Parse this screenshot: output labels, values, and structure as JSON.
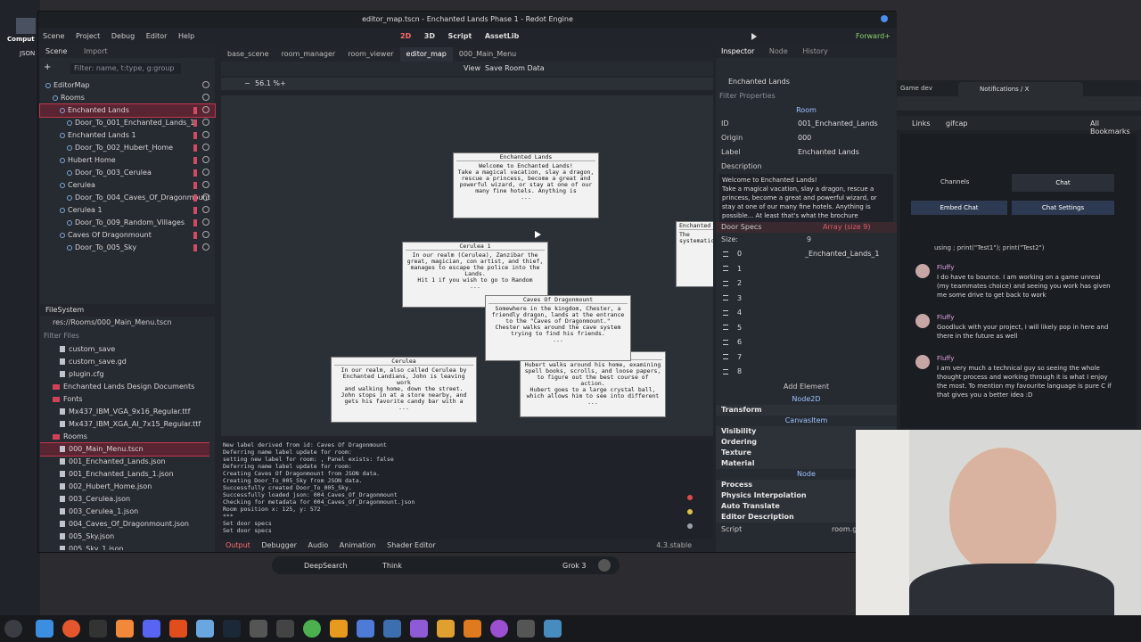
{
  "window_title": "editor_map.tscn - Enchanted Lands Phase 1 - Redot Engine",
  "menu": [
    "Scene",
    "Project",
    "Debug",
    "Editor",
    "Help"
  ],
  "workspaces": [
    "2D",
    "3D",
    "Script",
    "AssetLib"
  ],
  "renderer": "Forward+",
  "scene_panel": {
    "tabs": [
      "Scene",
      "Import"
    ],
    "filter_placeholder": "Filter: name, t:type, g:group",
    "tree": [
      {
        "label": "EditorMap",
        "indent": 0
      },
      {
        "label": "Rooms",
        "indent": 1
      },
      {
        "label": "Enchanted Lands",
        "indent": 2,
        "selected": true
      },
      {
        "label": "Door_To_001_Enchanted_Lands_1",
        "indent": 3
      },
      {
        "label": "Enchanted Lands 1",
        "indent": 2
      },
      {
        "label": "Door_To_002_Hubert_Home",
        "indent": 3
      },
      {
        "label": "Hubert Home",
        "indent": 2
      },
      {
        "label": "Door_To_003_Cerulea",
        "indent": 3
      },
      {
        "label": "Cerulea",
        "indent": 2
      },
      {
        "label": "Door_To_004_Caves_Of_Dragonmount",
        "indent": 3
      },
      {
        "label": "Cerulea 1",
        "indent": 2
      },
      {
        "label": "Door_To_009_Random_Villages",
        "indent": 3
      },
      {
        "label": "Caves Of Dragonmount",
        "indent": 2
      },
      {
        "label": "Door_To_005_Sky",
        "indent": 3
      }
    ]
  },
  "filesystem": {
    "title": "FileSystem",
    "path": "res://Rooms/000_Main_Menu.tscn",
    "filter_placeholder": "Filter Files",
    "items": [
      {
        "label": "custom_save",
        "type": "file",
        "indent": 2
      },
      {
        "label": "custom_save.gd",
        "type": "file",
        "indent": 2
      },
      {
        "label": "plugin.cfg",
        "type": "file",
        "indent": 2
      },
      {
        "label": "Enchanted Lands Design Documents",
        "type": "folder",
        "indent": 1
      },
      {
        "label": "Fonts",
        "type": "folder",
        "indent": 1
      },
      {
        "label": "Mx437_IBM_VGA_9x16_Regular.ttf",
        "type": "file",
        "indent": 2
      },
      {
        "label": "Mx437_IBM_XGA_AI_7x15_Regular.ttf",
        "type": "file",
        "indent": 2
      },
      {
        "label": "Rooms",
        "type": "folder",
        "indent": 1
      },
      {
        "label": "000_Main_Menu.tscn",
        "type": "file",
        "indent": 2,
        "selected": true
      },
      {
        "label": "001_Enchanted_Lands.json",
        "type": "file",
        "indent": 2
      },
      {
        "label": "001_Enchanted_Lands_1.json",
        "type": "file",
        "indent": 2
      },
      {
        "label": "002_Hubert_Home.json",
        "type": "file",
        "indent": 2
      },
      {
        "label": "003_Cerulea.json",
        "type": "file",
        "indent": 2
      },
      {
        "label": "003_Cerulea_1.json",
        "type": "file",
        "indent": 2
      },
      {
        "label": "004_Caves_Of_Dragonmount.json",
        "type": "file",
        "indent": 2
      },
      {
        "label": "005_Sky.json",
        "type": "file",
        "indent": 2
      },
      {
        "label": "005_Sky_1.json",
        "type": "file",
        "indent": 2
      }
    ]
  },
  "editor_tabs": [
    "base_scene",
    "room_manager",
    "room_viewer",
    "editor_map",
    "000_Main_Menu"
  ],
  "active_editor_tab": "editor_map",
  "toolbar": {
    "view": "View",
    "save_room_data": "Save Room Data",
    "zoom": "56.1 %"
  },
  "rooms": [
    {
      "title": "Enchanted Lands",
      "text": "Welcome to Enchanted Lands!\nTake a magical vacation, slay a dragon,\nrescue a princess, become a great and\npowerful wizard, or stay at one of our\nmany fine hotels. Anything is\n..."
    },
    {
      "title": "Cerulea 1",
      "text": "In our realm (Cerulea), Zanzibar the\ngreat, magician, con artist, and thief,\nmanages to escape the police into the\nLands.\nHit 1 if you wish to go to Random\n..."
    },
    {
      "title": "Caves Of Dragonmount",
      "text": "Somewhere in the kingdom, Chester, a\nfriendly dragon, lands at the entrance\nto the \"Caves of Dragonmount.\"\nChester walks around the cave system\ntrying to find his friends.\n..."
    },
    {
      "title": "Cerulea",
      "text": "In our realm, also called Cerulea by\nEnchanted Landians, John is leaving work\nand walking home, down the street.\nJohn stops in at a store nearby, and\ngets his favorite candy bar with a\n..."
    },
    {
      "title": "Hubert Home",
      "text": "Hubert walks around his home, examining\nspell books, scrolls, and loose papers,\nto figure out the best course of action.\nHubert goes to a large crystal ball,\nwhich allows him to see into different\n..."
    },
    {
      "title": "Enchanted",
      "text": "The\nsystematic"
    }
  ],
  "output_log": [
    "New label derived from id: Caves Of Dragonmount",
    "Deferring name label update for room:",
    "setting new label for room: , Panel exists: false",
    "Deferring name label update for room:",
    "Creating Caves Of Dragonmount from JSON data.",
    "Creating Door_To_005_Sky from JSON data.",
    "Successfully created Door_To_005_Sky.",
    "Successfully loaded json: 004_Caves_Of_Dragonmount",
    "Checking for metadata for 004_Caves_Of_Dragonmount.json",
    "Room position x: 125, y: 572",
    "***",
    "Set door specs",
    "Set door specs"
  ],
  "bottom_tabs": [
    "Output",
    "Debugger",
    "Audio",
    "Animation",
    "Shader Editor"
  ],
  "version": "4.3.stable",
  "inspector": {
    "tabs": [
      "Inspector",
      "Node",
      "History"
    ],
    "node_name": "Enchanted Lands",
    "filter_placeholder": "Filter Properties",
    "class": "Room",
    "id_label": "ID",
    "id_value": "001_Enchanted_Lands",
    "origin_label": "Origin",
    "origin_value": "000",
    "label_label": "Label",
    "label_value": "Enchanted Lands",
    "description_label": "Description",
    "description_text": "Welcome to Enchanted Lands!\nTake a magical vacation, slay a dragon, rescue a princess, become a great and powerful wizard, or stay at one of our many fine hotels. Anything is possible... At least that's what the brochure",
    "door_specs_label": "Door Specs",
    "door_specs_value": "Array (size 9)",
    "size_label": "Size:",
    "size_value": "9",
    "array_items": [
      "0",
      "1",
      "2",
      "3",
      "4",
      "5",
      "6",
      "7",
      "8"
    ],
    "array_first_value": "_Enchanted_Lands_1",
    "add_element": "Add Element",
    "node2d": "Node2D",
    "transform": "Transform",
    "canvasitem": "CanvasItem",
    "visibility": "Visibility",
    "ordering": "Ordering",
    "texture": "Texture",
    "material": "Material",
    "node": "Node",
    "process": "Process",
    "physics_interp": "Physics Interpolation",
    "auto_translate": "Auto Translate",
    "editor_description": "Editor Description",
    "script_label": "Script",
    "script_value": "room.gd"
  },
  "browser": {
    "tab_title": "Notifications / X",
    "tab_left": "Game dev",
    "bookmarks": [
      "Links",
      "gifcap",
      "All Bookmarks"
    ],
    "channels": "Channels",
    "chat": "Chat",
    "embed_chat": "Embed Chat",
    "chat_settings": "Chat Settings",
    "top_snippet": "using ; print(\"Test1\"); print(\"Test2\")",
    "messages": [
      {
        "name": "Fluffy",
        "text": "I do have to bounce. I am working on a game unreal (my teammates choice) and seeing you work has given me some drive to get back to work"
      },
      {
        "name": "Fluffy",
        "text": "Goodluck with your project, I will likely pop in here and there in the future as well"
      },
      {
        "name": "Fluffy",
        "text": "I am very much a technical guy so seeing the whole thought process and working through it is what I enjoy the most. To mention my favourite language is pure C if that gives you a better idea :D"
      }
    ]
  },
  "grok_bar": {
    "deepsearch": "DeepSearch",
    "think": "Think",
    "model": "Grok 3"
  },
  "desktop_left": {
    "computer": "Comput",
    "json": "JSON"
  },
  "colors": {
    "accent": "#ff6a6a",
    "selected_row": "#5a2533",
    "panel": "#262a31",
    "canvas": "#2b2f36"
  }
}
